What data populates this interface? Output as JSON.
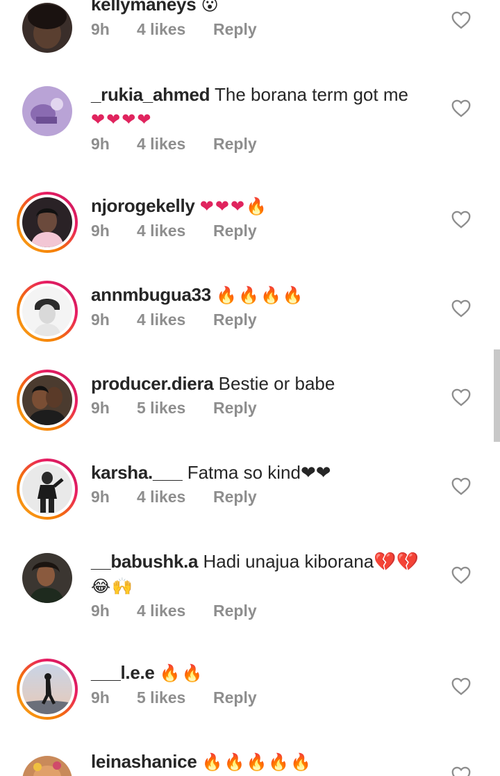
{
  "comments": [
    {
      "username": "kellymaneys",
      "text": "😮",
      "time": "9h",
      "likes": "4 likes",
      "reply": "Reply",
      "avatar": "avatar-dark-portrait",
      "story_ring": false
    },
    {
      "username": "_rukia_ahmed",
      "text": "The borana term got me",
      "text2": "❤❤❤❤",
      "time": "9h",
      "likes": "4 likes",
      "reply": "Reply",
      "avatar": "avatar-purple-photo",
      "story_ring": false
    },
    {
      "username": "njorogekelly",
      "text": "❤❤❤🔥",
      "time": "9h",
      "likes": "4 likes",
      "reply": "Reply",
      "avatar": "avatar-woman-portrait",
      "story_ring": true
    },
    {
      "username": "annmbugua33",
      "text": "🔥🔥🔥🔥",
      "time": "9h",
      "likes": "4 likes",
      "reply": "Reply",
      "avatar": "avatar-beanie-portrait",
      "story_ring": true
    },
    {
      "username": "producer.diera",
      "text": "Bestie or babe",
      "time": "9h",
      "likes": "5 likes",
      "reply": "Reply",
      "avatar": "avatar-couple-photo",
      "story_ring": true
    },
    {
      "username": "karsha.___",
      "text": "Fatma so kind❤❤",
      "time": "9h",
      "likes": "4 likes",
      "reply": "Reply",
      "avatar": "avatar-standing-figure",
      "story_ring": true
    },
    {
      "username": "__babushk.a",
      "text": "Hadi unajua kiborana💔💔",
      "text2": "😂🙌",
      "time": "9h",
      "likes": "4 likes",
      "reply": "Reply",
      "avatar": "avatar-girl-dark-photo",
      "story_ring": false
    },
    {
      "username": "___l.e.e",
      "text": "🔥🔥",
      "time": "9h",
      "likes": "5 likes",
      "reply": "Reply",
      "avatar": "avatar-silhouette-sky",
      "story_ring": true
    },
    {
      "username": "leinashanice",
      "text": "🔥🔥🔥🔥🔥",
      "avatar": "avatar-partial",
      "story_ring": false
    }
  ],
  "colors": {
    "text": "#262626",
    "meta": "#8e8e8e",
    "heart_outline": "#8e8e8e"
  }
}
